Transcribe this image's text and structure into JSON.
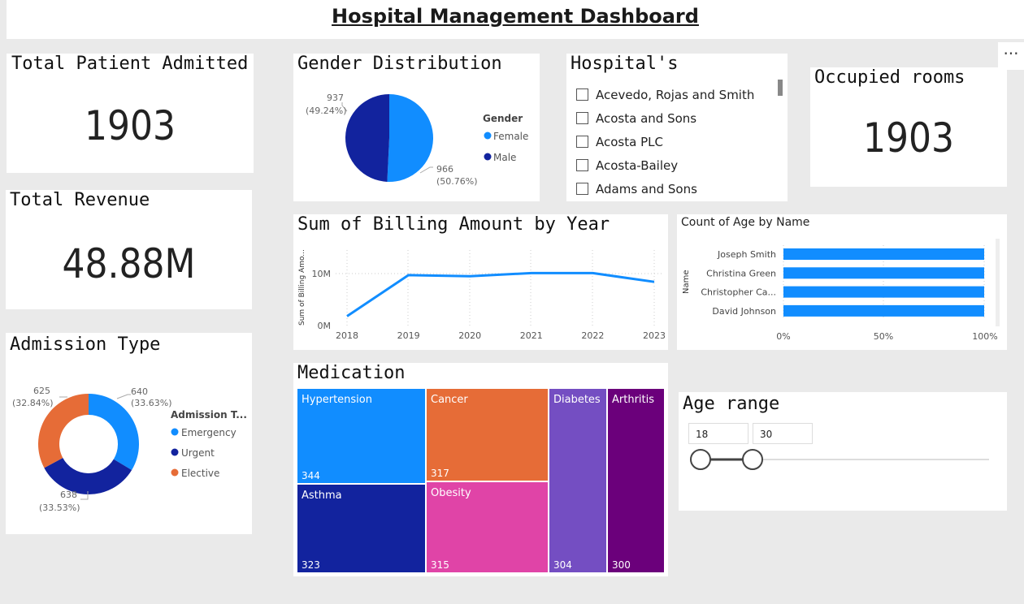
{
  "title": "Hospital Management Dashboard",
  "more_options": "···",
  "kpis": {
    "patients": {
      "title": "Total Patient Admitted",
      "value": "1903"
    },
    "revenue": {
      "title": "Total Revenue",
      "value": "48.88M"
    },
    "rooms": {
      "title": "Occupied rooms",
      "value": "1903"
    }
  },
  "gender": {
    "title": "Gender Distribution",
    "legend_title": "Gender",
    "female_label": "Female",
    "male_label": "Male",
    "female_value": "966",
    "female_pct": "(50.76%)",
    "male_value": "937",
    "male_pct": "(49.24%)",
    "colors": {
      "female": "#118dff",
      "male": "#12239e"
    }
  },
  "hospitals": {
    "title": "Hospital's",
    "items": [
      "Acevedo, Rojas and Smith",
      "Acosta and Sons",
      "Acosta PLC",
      "Acosta-Bailey",
      "Adams and Sons"
    ]
  },
  "admission": {
    "title": "Admission Type",
    "legend_title": "Admission T...",
    "emergency_label": "Emergency",
    "urgent_label": "Urgent",
    "elective_label": "Elective",
    "emergency_value": "640",
    "emergency_pct": "(33.63%)",
    "urgent_value": "638",
    "urgent_pct": "(33.53%)",
    "elective_value": "625",
    "elective_pct": "(32.84%)",
    "colors": {
      "emergency": "#118dff",
      "urgent": "#12239e",
      "elective": "#e66c37"
    }
  },
  "billing": {
    "title": "Sum of Billing Amount by Year",
    "ylabel": "Sum of Billing Amo...",
    "ytick_10m": "10M",
    "ytick_0m": "0M",
    "years": [
      "2018",
      "2019",
      "2020",
      "2021",
      "2022",
      "2023"
    ]
  },
  "age_by_name": {
    "title": "Count of Age by Name",
    "ylabel": "Name",
    "names": [
      "Joseph Smith",
      "Christina Green",
      "Christopher Ca...",
      "David Johnson"
    ],
    "xticks": [
      "0%",
      "50%",
      "100%"
    ]
  },
  "medication": {
    "title": "Medication",
    "tiles": [
      {
        "label": "Hypertension",
        "value": "344"
      },
      {
        "label": "Cancer",
        "value": "317"
      },
      {
        "label": "Diabetes",
        "value": "304"
      },
      {
        "label": "Arthritis",
        "value": "300"
      },
      {
        "label": "Asthma",
        "value": "323"
      },
      {
        "label": "Obesity",
        "value": "315"
      }
    ]
  },
  "age_range": {
    "title": "Age range",
    "min": "18",
    "max": "30"
  },
  "chart_data": [
    {
      "type": "pie",
      "title": "Gender Distribution",
      "categories": [
        "Female",
        "Male"
      ],
      "values": [
        966,
        937
      ]
    },
    {
      "type": "pie",
      "title": "Admission Type",
      "categories": [
        "Emergency",
        "Urgent",
        "Elective"
      ],
      "values": [
        640,
        638,
        625
      ]
    },
    {
      "type": "line",
      "title": "Sum of Billing Amount by Year",
      "x": [
        "2018",
        "2019",
        "2020",
        "2021",
        "2022",
        "2023"
      ],
      "values": [
        1800000,
        9700000,
        9500000,
        10100000,
        10100000,
        8400000
      ],
      "ylabel": "Sum of Billing Amo...",
      "ylim": [
        0,
        14000000
      ]
    },
    {
      "type": "bar",
      "title": "Count of Age by Name",
      "categories": [
        "Joseph Smith",
        "Christina Green",
        "Christopher Ca...",
        "David Johnson"
      ],
      "values": [
        100,
        100,
        100,
        100
      ],
      "ylabel": "Name",
      "xlim": [
        0,
        100
      ]
    },
    {
      "type": "table",
      "title": "Medication",
      "categories": [
        "Hypertension",
        "Asthma",
        "Cancer",
        "Obesity",
        "Diabetes",
        "Arthritis"
      ],
      "values": [
        344,
        323,
        317,
        315,
        304,
        300
      ]
    }
  ]
}
